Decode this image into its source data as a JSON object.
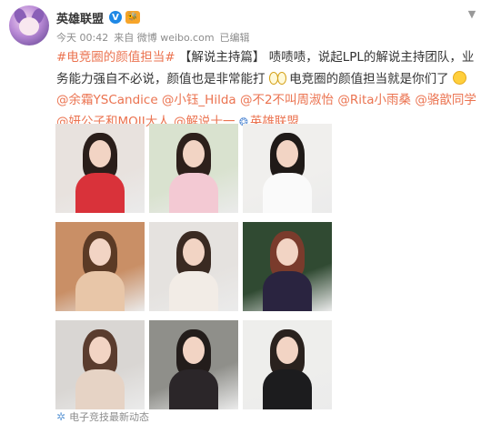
{
  "post": {
    "author": "英雄联盟",
    "verified_badge": "V",
    "level_badge": "🐝",
    "meta": {
      "time": "今天 00:42",
      "source_prefix": "来自",
      "source": "微博 weibo.com",
      "edited": "已编辑"
    },
    "text": {
      "hashtag": "#电竞圈的颜值担当#",
      "tag": "【解说主持篇】",
      "body_1": "啧啧啧，说起LPL的解说主持团队，业务能力强自不必说，颜值也是非常能打",
      "body_2": "电竞圈的颜值担当就是你们了",
      "mentions": [
        "@余霜YSCandice",
        "@小钰_Hilda",
        "@不2不叫周淑怡",
        "@Rita小雨桑",
        "@骆歆同学",
        "@妍公子和MOJI大人",
        "@解说十一"
      ],
      "topic_link": "英雄联盟"
    },
    "footer": {
      "app_name": "电子竞技最新动态"
    }
  },
  "photos": [
    {
      "label": "photo-1",
      "bg": "#e8e2de",
      "dress": "#d9323a",
      "hair": "#2a1e1a"
    },
    {
      "label": "photo-2",
      "bg": "#d9e2cf",
      "dress": "#f3c9d3",
      "hair": "#2d201b"
    },
    {
      "label": "photo-3",
      "bg": "#f0efed",
      "dress": "#fafafa",
      "hair": "#1f1a18"
    },
    {
      "label": "photo-4",
      "bg": "#c98f66",
      "dress": "#e8c6a8",
      "hair": "#5b3a25"
    },
    {
      "label": "photo-5",
      "bg": "#e5e2df",
      "dress": "#f2ece6",
      "hair": "#3a2a22"
    },
    {
      "label": "photo-6",
      "bg": "#304a32",
      "dress": "#2a2440",
      "hair": "#7a3b2c"
    },
    {
      "label": "photo-7",
      "bg": "#d9d6d3",
      "dress": "#e6d3c5",
      "hair": "#5a3c2e"
    },
    {
      "label": "photo-8",
      "bg": "#8f8f8a",
      "dress": "#2b2629",
      "hair": "#231d1b"
    },
    {
      "label": "photo-9",
      "bg": "#eeeeec",
      "dress": "#1c1c1e",
      "hair": "#2a221e"
    }
  ]
}
